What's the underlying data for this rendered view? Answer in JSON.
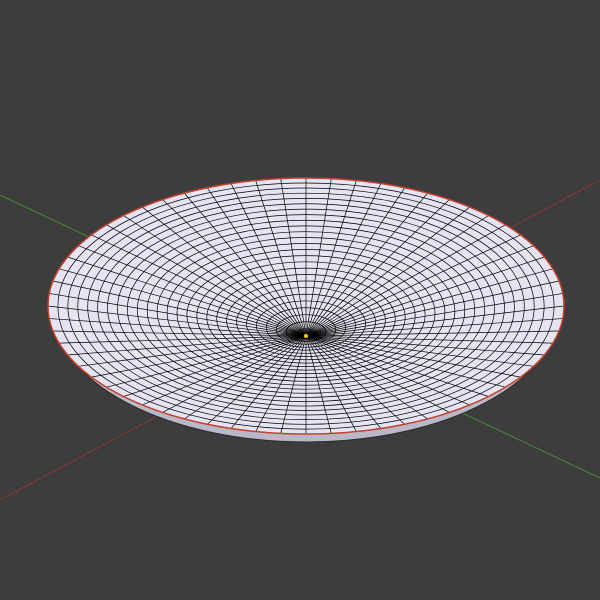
{
  "viewport": {
    "name": "3D Viewport",
    "background_color": "#3d3d3d",
    "shading": "wireframe-overlay",
    "axes": {
      "x_axis_color": "#8a3a3a",
      "y_axis_color": "#4a8a3a"
    }
  },
  "object": {
    "type": "mesh",
    "shape": "shallow dish / UV-sphere cap",
    "selected": true,
    "face_color": "#e4e4f2",
    "wire_color": "#000000",
    "outline_color": "#c8402a",
    "rings": 26,
    "segments": 64
  },
  "origin": {
    "color_center": "#f0c000"
  }
}
